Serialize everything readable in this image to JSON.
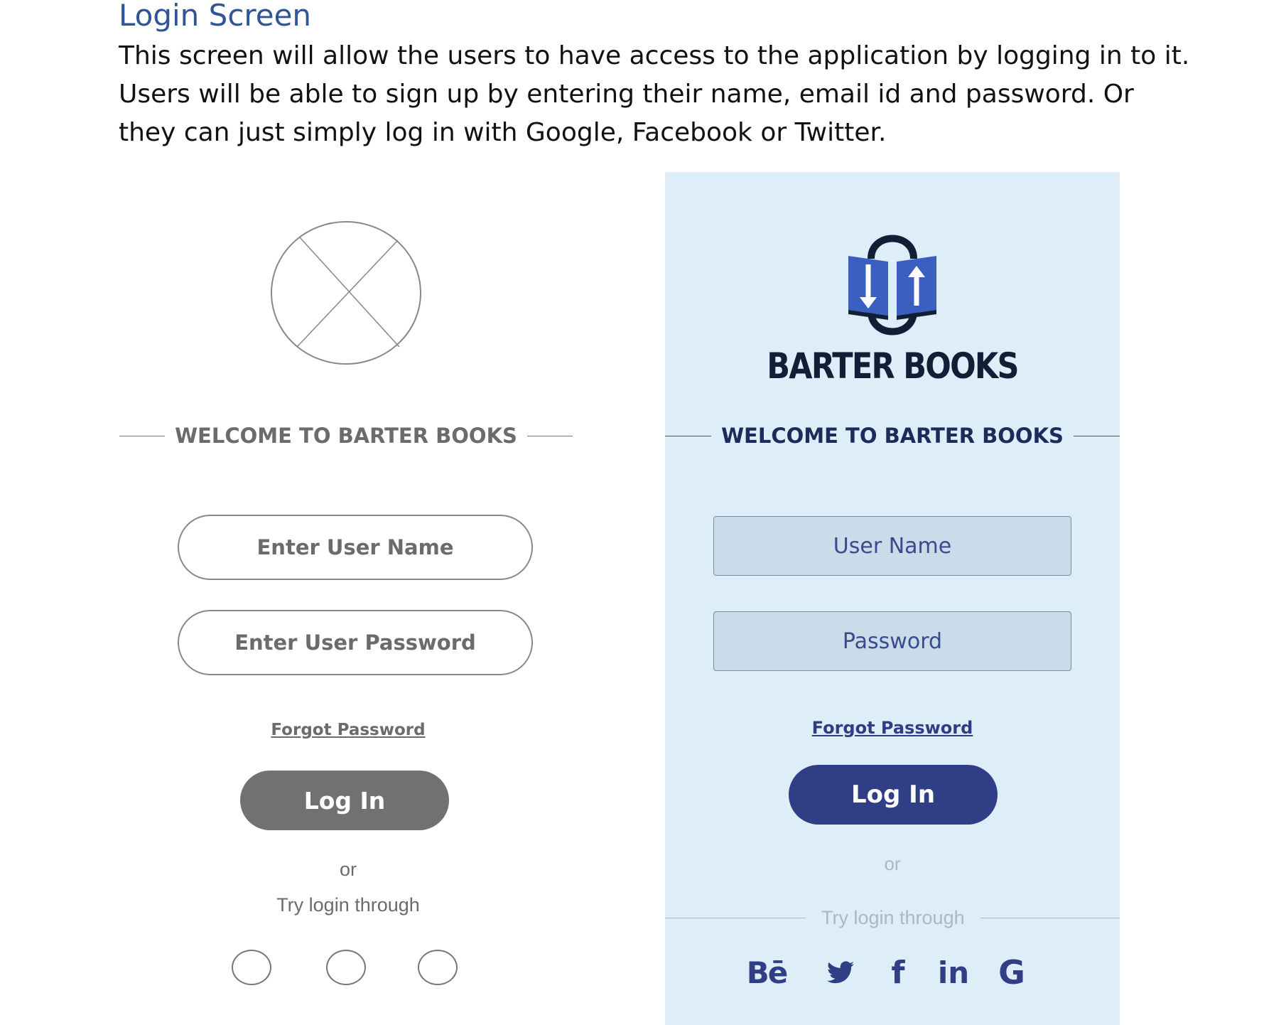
{
  "document": {
    "title": "Login Screen",
    "paragraph": "This screen will allow the users to have access to the application by logging in to it. Users will be able to sign up by entering their name, email id and password. Or they can just simply log in with Google, Facebook or Twitter."
  },
  "wireframe": {
    "welcome": "WELCOME TO BARTER BOOKS",
    "username_placeholder": "Enter User Name",
    "password_placeholder": "Enter User Password",
    "forgot": "Forgot Password",
    "login": "Log In",
    "or": "or",
    "try": "Try login through"
  },
  "mockup": {
    "brand": "BARTER BOOKS",
    "welcome": "WELCOME TO BARTER BOOKS",
    "username_placeholder": "User Name",
    "password_placeholder": "Password",
    "forgot": "Forgot Password",
    "login": "Log In",
    "or": "or",
    "try": "Try login through",
    "social": [
      {
        "icon": "behance-icon",
        "glyph": "Bē"
      },
      {
        "icon": "twitter-icon",
        "glyph": ""
      },
      {
        "icon": "facebook-icon",
        "glyph": "f"
      },
      {
        "icon": "linkedin-icon",
        "glyph": "in"
      },
      {
        "icon": "google-icon",
        "glyph": "G"
      }
    ],
    "colors": {
      "background": "#ddeef9",
      "primary": "#303e86",
      "brand_text": "#111e35"
    }
  }
}
